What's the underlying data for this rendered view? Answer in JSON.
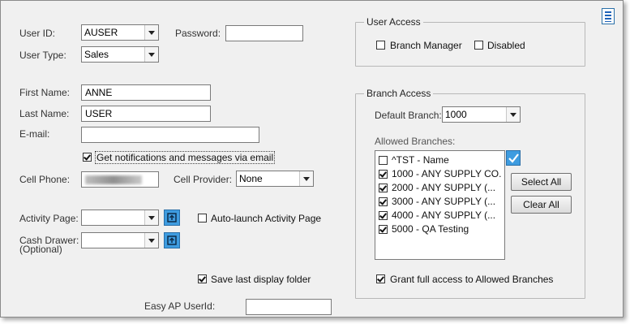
{
  "user": {
    "user_id_label": "User ID:",
    "user_id_value": "AUSER",
    "password_label": "Password:",
    "password_value": "",
    "user_type_label": "User Type:",
    "user_type_value": "Sales",
    "first_name_label": "First Name:",
    "first_name_value": "ANNE",
    "last_name_label": "Last Name:",
    "last_name_value": "USER",
    "email_label": "E-mail:",
    "email_value": "",
    "notifications_label": "Get notifications and messages via email",
    "notifications_checked": true,
    "cell_phone_label": "Cell Phone:",
    "cell_provider_label": "Cell Provider:",
    "cell_provider_value": "None",
    "activity_page_label": "Activity Page:",
    "activity_page_value": "",
    "auto_launch_label": "Auto-launch Activity Page",
    "auto_launch_checked": false,
    "cash_drawer_label": "Cash Drawer:",
    "cash_drawer_optional": "(Optional)",
    "cash_drawer_value": "",
    "save_folder_label": "Save last display folder",
    "save_folder_checked": true,
    "easy_ap_label": "Easy AP UserId:",
    "easy_ap_value": ""
  },
  "user_access": {
    "title": "User Access",
    "branch_manager_label": "Branch Manager",
    "branch_manager_checked": false,
    "disabled_label": "Disabled",
    "disabled_checked": false
  },
  "branch_access": {
    "title": "Branch Access",
    "default_branch_label": "Default Branch:",
    "default_branch_value": "1000",
    "allowed_label": "Allowed Branches:",
    "branches": [
      {
        "label": "^TST - Name",
        "checked": false
      },
      {
        "label": "1000 - ANY SUPPLY CO.",
        "checked": true
      },
      {
        "label": "2000 - ANY SUPPLY (...",
        "checked": true
      },
      {
        "label": "3000 - ANY SUPPLY (...",
        "checked": true
      },
      {
        "label": "4000 - ANY SUPPLY (...",
        "checked": true
      },
      {
        "label": "5000 - QA Testing",
        "checked": true
      }
    ],
    "select_all_label": "Select All",
    "clear_all_label": "Clear All",
    "grant_full_label": "Grant full access to Allowed Branches",
    "grant_full_checked": true
  },
  "icons": {
    "menu": "menu-icon",
    "open_activity": "open-page-icon",
    "open_drawer": "open-page-icon",
    "check_all": "checkmark-icon"
  },
  "colors": {
    "accent": "#3e9ce0",
    "window_bg": "#f0f0f0"
  }
}
